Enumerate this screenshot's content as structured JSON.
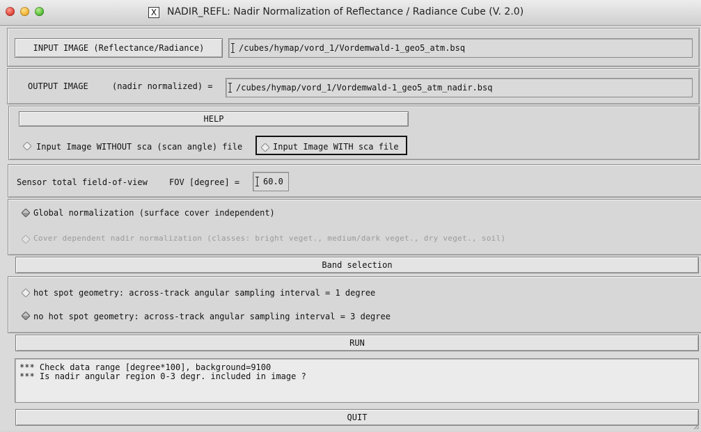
{
  "window": {
    "title": "NADIR_REFL:  Nadir Normalization of Reflectance / Radiance Cube  (V. 2.0)",
    "title_icon": "X"
  },
  "input_section": {
    "button_label": "INPUT IMAGE (Reflectance/Radiance)",
    "path_value": "/cubes/hymap/vord_1/Vordemwald-1_geo5_atm.bsq"
  },
  "output_section": {
    "label": "OUTPUT IMAGE",
    "sublabel": "(nadir normalized) =",
    "path_value": "/cubes/hymap/vord_1/Vordemwald-1_geo5_atm_nadir.bsq"
  },
  "help_section": {
    "help_label": "HELP",
    "option_without_sca": "Input Image WITHOUT sca (scan angle) file",
    "option_with_sca": "Input Image WITH sca file"
  },
  "fov_section": {
    "label": "Sensor total field-of-view",
    "fov_label": "FOV [degree] =",
    "fov_value": "60.0"
  },
  "normalization_section": {
    "global_label": "Global normalization (surface cover independent)",
    "cover_label": "Cover dependent nadir normalization (classes: bright veget., medium/dark veget., dry veget., soil)"
  },
  "band_selection_label": "Band selection",
  "geometry_section": {
    "hot_spot_label": "hot spot geometry: across-track angular sampling interval = 1 degree",
    "no_hot_spot_label": "no hot spot geometry: across-track angular sampling interval = 3 degree"
  },
  "run_label": "RUN",
  "messages": {
    "line1": "*** Check data range [degree*100], background=9100",
    "line2": "*** Is nadir angular region 0-3 degr. included in image ?"
  },
  "quit_label": "QUIT",
  "colors": {
    "background": "#d6d6d6",
    "dimmed_text": "#9a9a9a"
  }
}
